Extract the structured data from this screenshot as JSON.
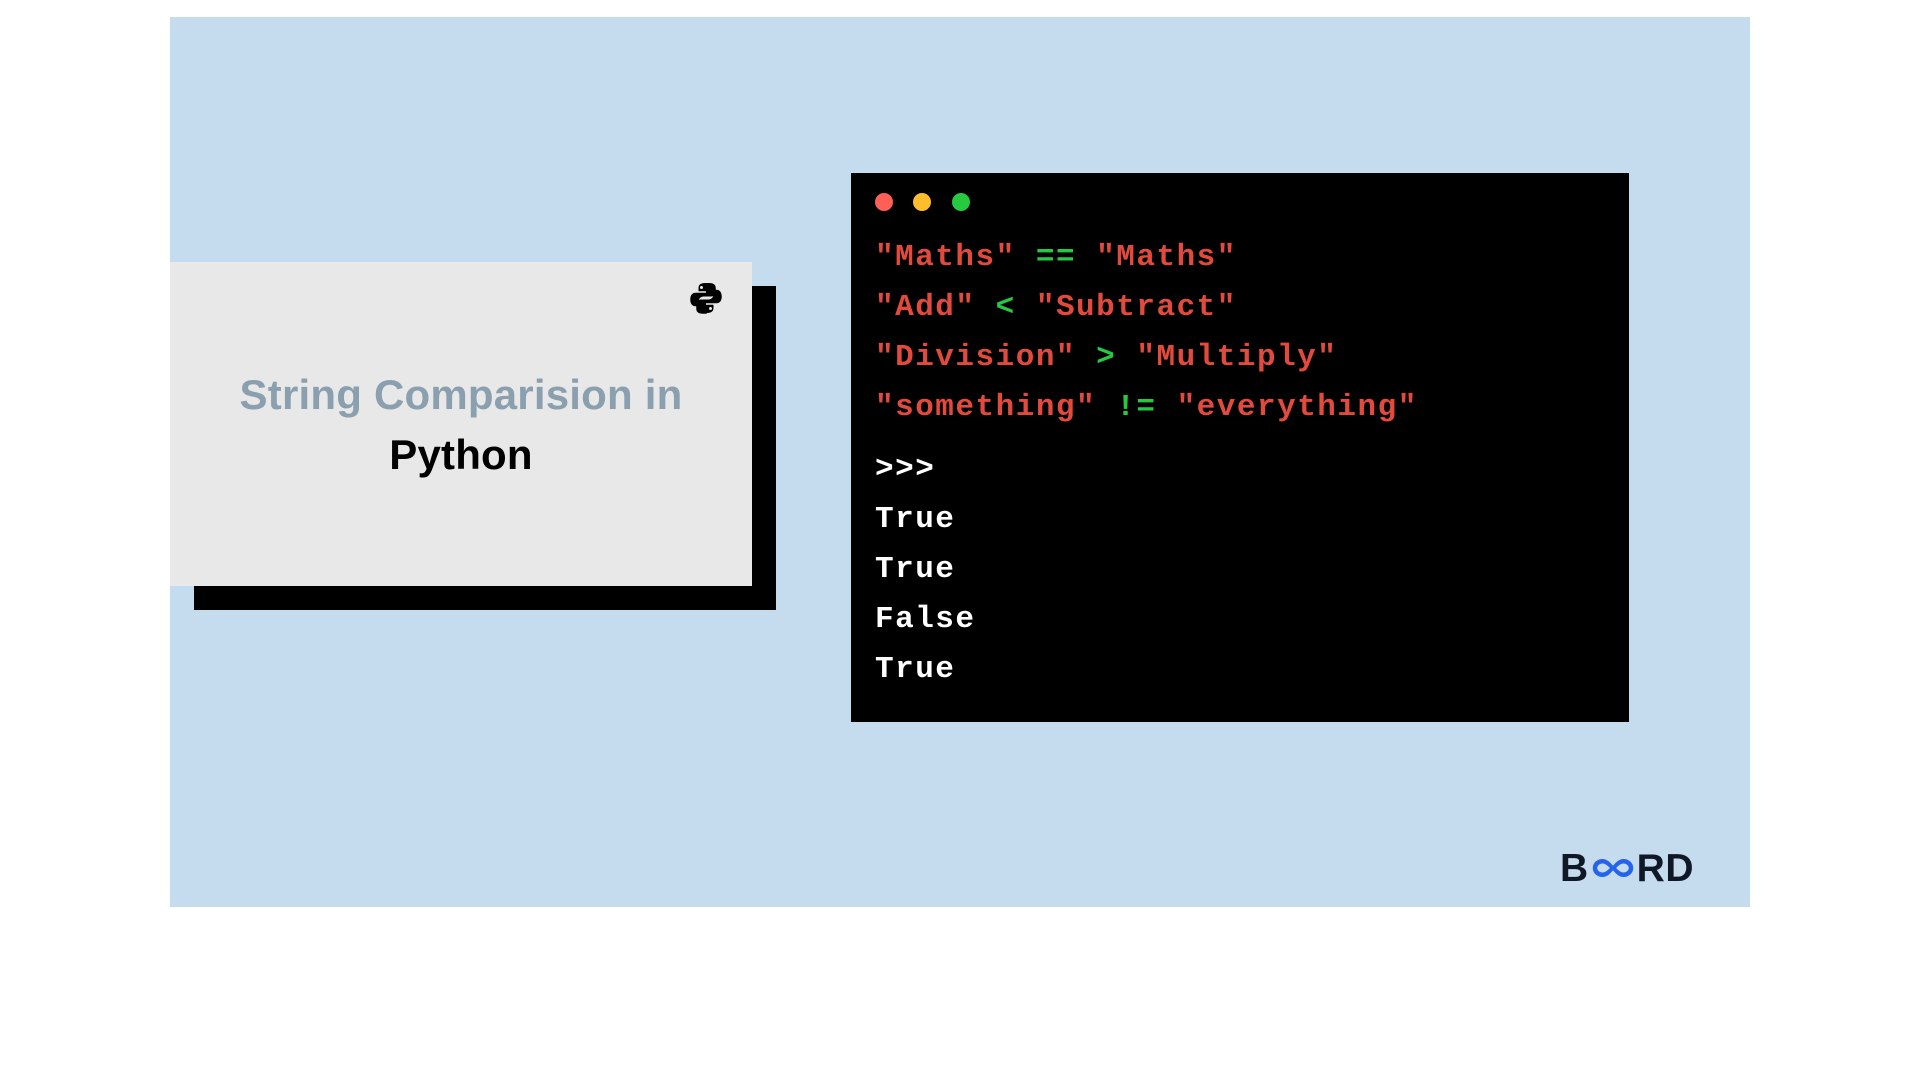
{
  "card": {
    "title_line1": "String Comparision in",
    "title_line2": "Python"
  },
  "code": {
    "lines": [
      {
        "left": "\"Maths\"",
        "op": "==",
        "right": "\"Maths\""
      },
      {
        "left": "\"Add\"",
        "op": "<",
        "right": "\"Subtract\""
      },
      {
        "left": "\"Division\"",
        "op": ">",
        "right": "\"Multiply\""
      },
      {
        "left": "\"something\"",
        "op": "!=",
        "right": "\"everything\""
      }
    ],
    "prompt": ">>>",
    "output": [
      "True",
      "True",
      "False",
      "True"
    ]
  },
  "brand": {
    "b": "B",
    "rd": "RD"
  },
  "colors": {
    "bg": "#c4dcee",
    "card": "#e8e8e8",
    "title_muted": "#8aa0af",
    "black": "#000000",
    "code_str": "#e14a3c",
    "code_op": "#27c93f",
    "code_out": "#ffffff",
    "brand_blue": "#2563eb"
  }
}
